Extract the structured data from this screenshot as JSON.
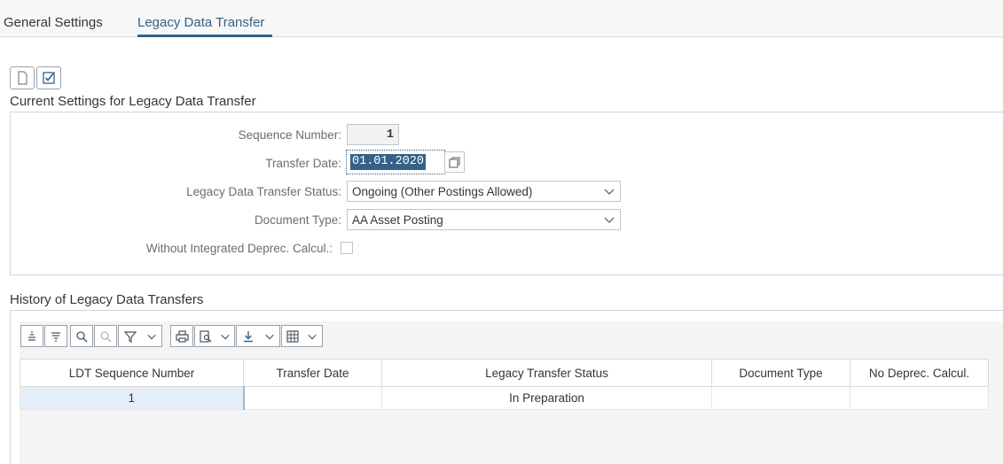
{
  "tabs": [
    {
      "label": "General Settings",
      "active": false
    },
    {
      "label": "Legacy Data Transfer",
      "active": true
    }
  ],
  "toolbar": {
    "icons": [
      "document-icon",
      "check-icon"
    ]
  },
  "current_settings": {
    "title": "Current Settings for Legacy Data Transfer",
    "sequence_number_label": "Sequence Number:",
    "sequence_number_value": "1",
    "transfer_date_label": "Transfer Date:",
    "transfer_date_value": "01.01.2020",
    "status_label": "Legacy Data Transfer Status:",
    "status_value": "Ongoing (Other Postings Allowed)",
    "doc_type_label": "Document Type:",
    "doc_type_value": "AA Asset Posting",
    "without_integrated_label": "Without Integrated Deprec. Calcul.:",
    "without_integrated_checked": false
  },
  "history": {
    "title": "History of Legacy Data Transfers",
    "toolbar_icons": [
      "align-top-icon",
      "align-bottom-icon",
      "find-icon",
      "find-next-icon",
      "filter-icon",
      "dropdown-icon",
      "print-icon",
      "print-preview-icon",
      "dropdown-icon",
      "export-icon",
      "dropdown-icon",
      "layout-icon",
      "dropdown-icon"
    ],
    "columns": [
      "LDT Sequence Number",
      "Transfer Date",
      "Legacy Transfer Status",
      "Document Type",
      "No Deprec. Calcul."
    ],
    "rows": [
      [
        "1",
        "",
        "In Preparation",
        "",
        ""
      ]
    ]
  },
  "colors": {
    "accent": "#346187",
    "panel_border": "#d0d5da"
  }
}
